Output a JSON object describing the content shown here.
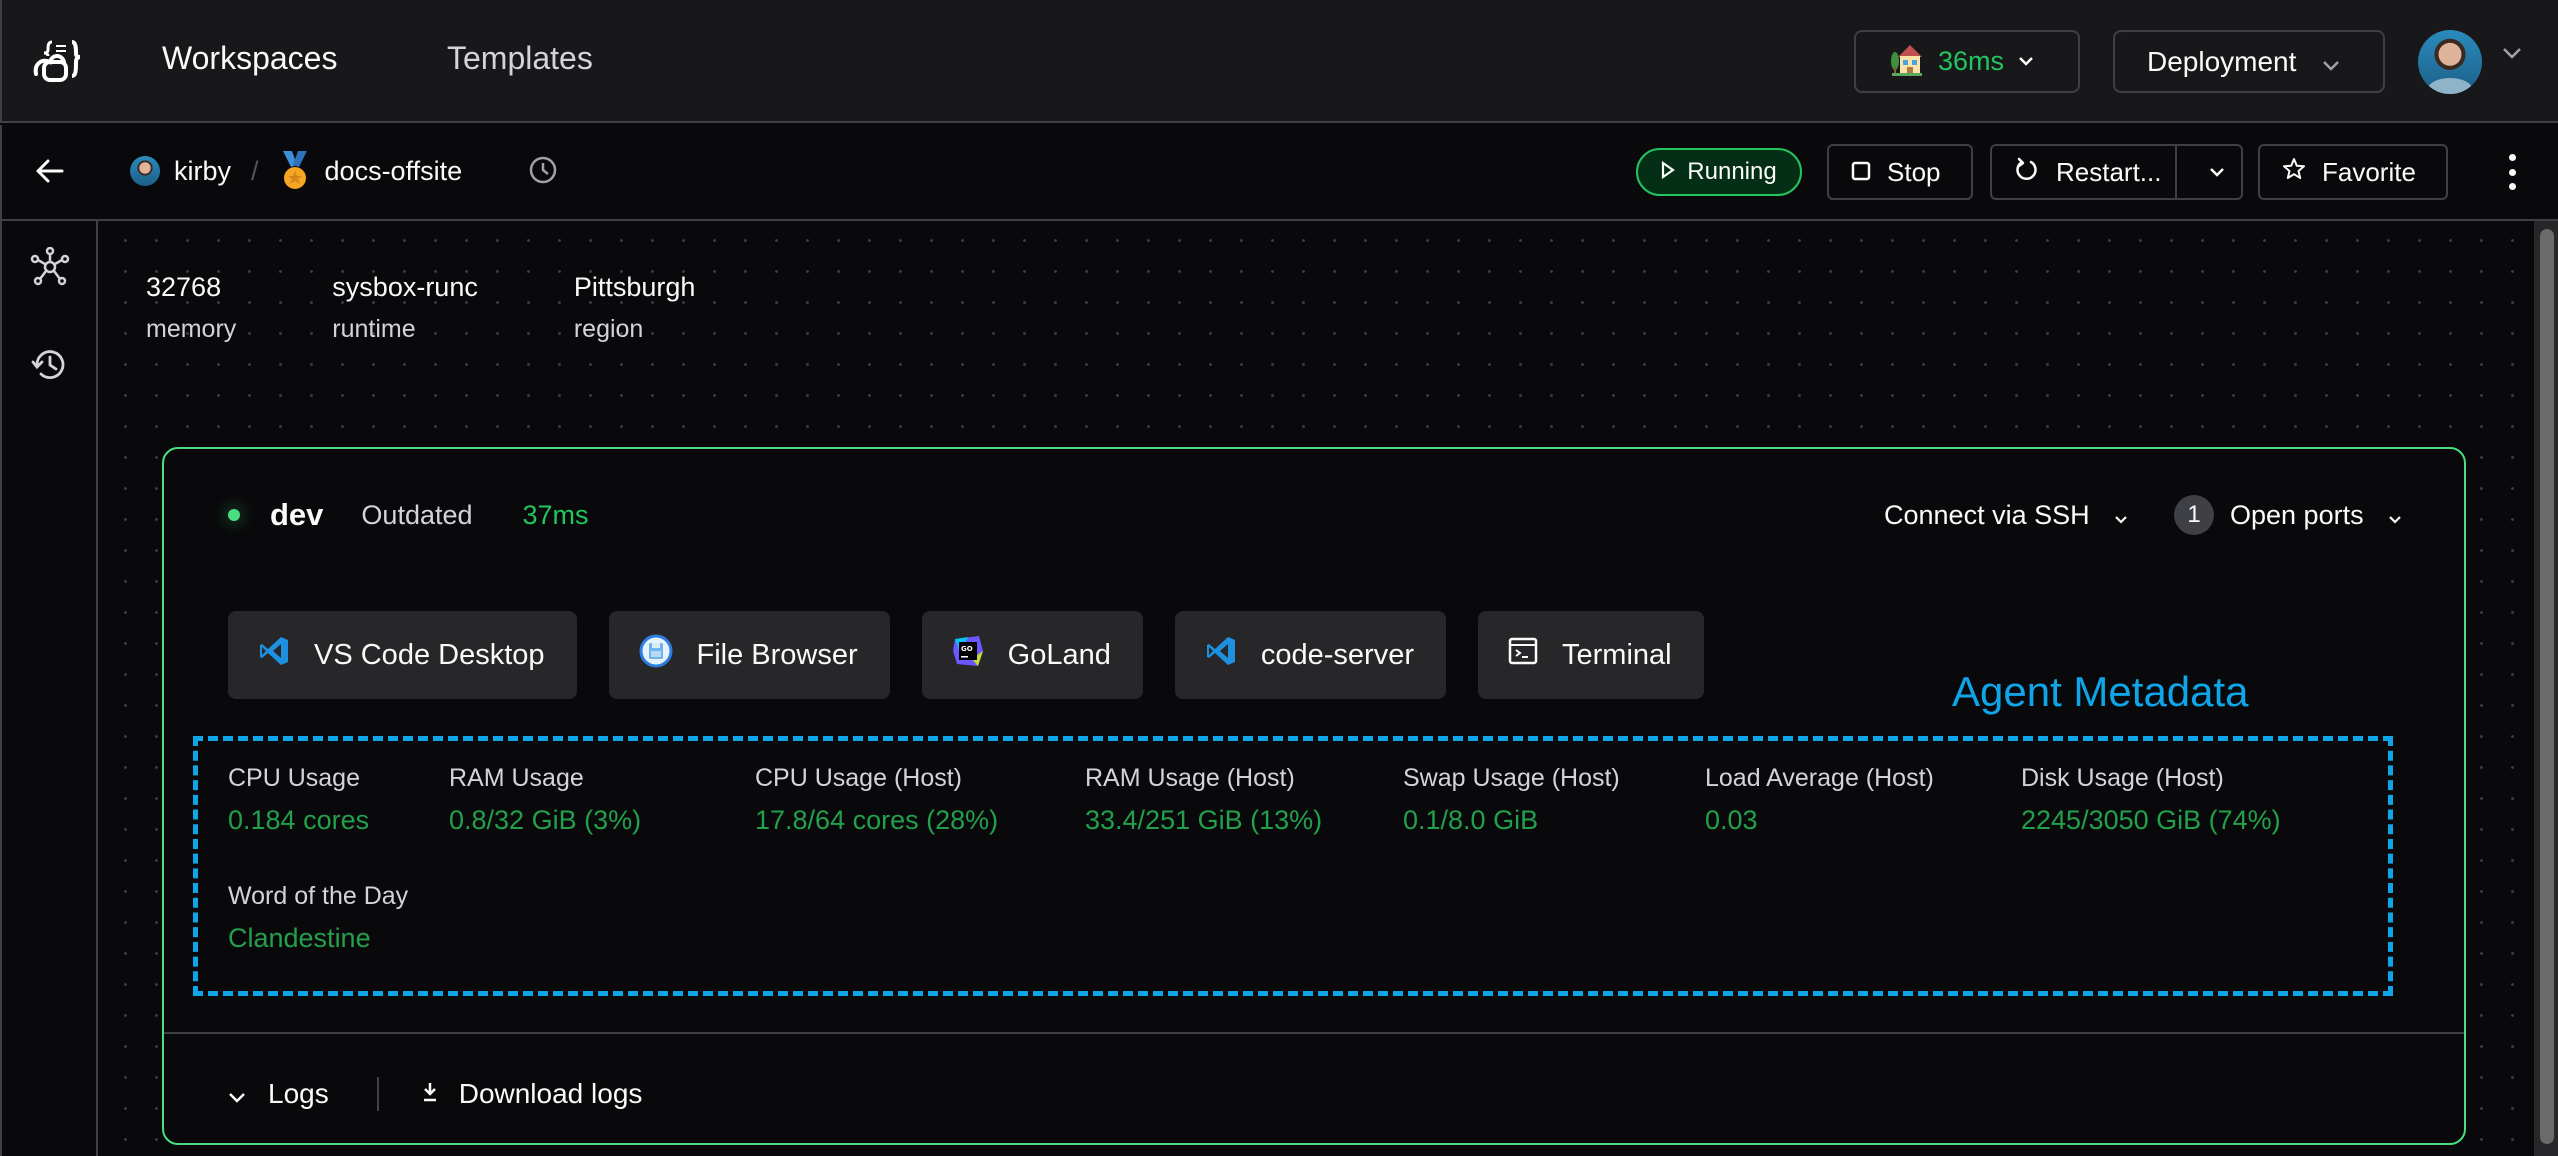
{
  "nav": {
    "logo_icon": "coder-logo-icon",
    "links": [
      {
        "label": "Workspaces",
        "active": true
      },
      {
        "label": "Templates",
        "active": false
      }
    ],
    "proxy": {
      "icon": "house-emoji-icon",
      "latency": "36ms"
    },
    "deployment_label": "Deployment",
    "user_menu_icon": "avatar"
  },
  "subheader": {
    "back_icon": "arrow-left-icon",
    "breadcrumb": {
      "owner": "kirby",
      "separator": "/",
      "workspace": "docs-offsite",
      "workspace_icon": "medal-icon"
    },
    "history_icon": "clock-icon",
    "status": "Running",
    "actions": {
      "stop": "Stop",
      "restart": "Restart...",
      "favorite": "Favorite"
    }
  },
  "siderail": {
    "items": [
      {
        "icon": "resources-hub-icon"
      },
      {
        "icon": "history-icon"
      }
    ]
  },
  "stats": [
    {
      "value": "32768",
      "label": "memory"
    },
    {
      "value": "sysbox-runc",
      "label": "runtime"
    },
    {
      "value": "Pittsburgh",
      "label": "region"
    }
  ],
  "agent": {
    "name": "dev",
    "version_status": "Outdated",
    "latency": "37ms",
    "status_color": "#4ade80",
    "ssh_label": "Connect via SSH",
    "ports_count": "1",
    "ports_label": "Open ports",
    "apps": [
      {
        "label": "VS Code Desktop",
        "icon": "vscode-icon"
      },
      {
        "label": "File Browser",
        "icon": "file-browser-icon"
      },
      {
        "label": "GoLand",
        "icon": "goland-icon"
      },
      {
        "label": "code-server",
        "icon": "vscode-icon"
      },
      {
        "label": "Terminal",
        "icon": "terminal-icon"
      }
    ],
    "annotation_label": "Agent Metadata",
    "metadata": [
      {
        "label": "CPU Usage",
        "value": "0.184 cores"
      },
      {
        "label": "RAM Usage",
        "value": "0.8/32 GiB (3%)"
      },
      {
        "label": "CPU Usage (Host)",
        "value": "17.8/64 cores (28%)"
      },
      {
        "label": "RAM Usage (Host)",
        "value": "33.4/251 GiB (13%)"
      },
      {
        "label": "Swap Usage (Host)",
        "value": "0.1/8.0 GiB"
      },
      {
        "label": "Load Average (Host)",
        "value": "0.03"
      },
      {
        "label": "Disk Usage (Host)",
        "value": "2245/3050 GiB (74%)"
      },
      {
        "label": "Word of the Day",
        "value": "Clandestine"
      }
    ],
    "logs_label": "Logs",
    "download_logs_label": "Download logs"
  },
  "colors": {
    "accent_green": "#22c55e",
    "annotation_blue": "#0ea5e9",
    "card_border": "#4ade80"
  }
}
